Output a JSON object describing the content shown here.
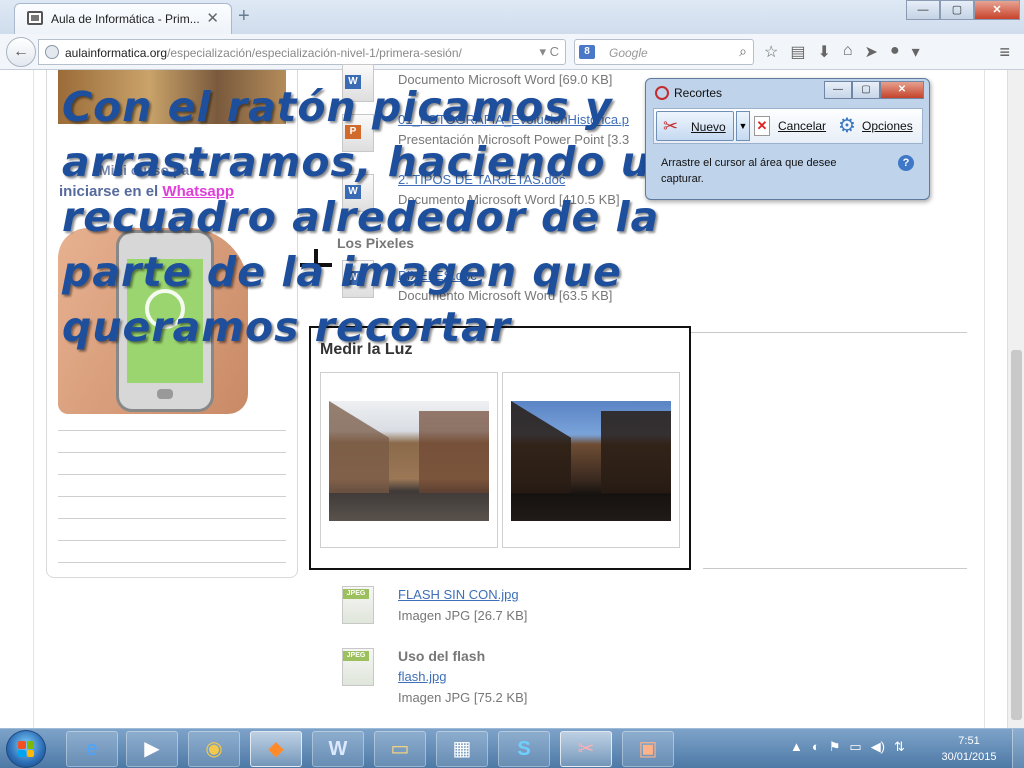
{
  "browser": {
    "tab_title": "Aula de Informática - Prim...",
    "tab_close": "✕",
    "new_tab": "+",
    "window_controls": [
      "—",
      "▢",
      "✕"
    ],
    "back": "←",
    "url_host": "aulainformatica.org",
    "url_path": "/especialización/especialización-nivel-1/primera-sesión/",
    "url_controls": "▾  C",
    "search_placeholder": "Google",
    "search_engine_letter": "8",
    "toolbar_icons": [
      "☆",
      "▤",
      "⬇",
      "⌂",
      "➤",
      "●",
      "▾"
    ],
    "menu": "≡"
  },
  "sidebar": {
    "promo_line1": "Mini curso para",
    "promo_line2_prefix": "iniciarse en el",
    "promo_line2_link": "Whatsapp"
  },
  "files": [
    {
      "meta": "Documento Microsoft Word [69.0 KB]"
    },
    {
      "link": "01_FOTOGRAFIA_EvolucionHistorica.p",
      "meta": "Presentación Microsoft Power Point [3.3"
    },
    {
      "link": "2. TIPOS DE TARJETAS.doc",
      "meta": "Documento Microsoft Word [410.5 KB]"
    }
  ],
  "section_pixeles": {
    "title": "Los Pixeles",
    "link": "PIXELES.doc",
    "meta": "Documento Microsoft Word [63.5 KB]"
  },
  "measure": {
    "title": "Medir la Luz"
  },
  "flash_files": [
    {
      "link": "FLASH SIN CON.jpg",
      "meta": "Imagen JPG [26.7 KB]"
    },
    {
      "section": "Uso del flash",
      "link": "flash.jpg",
      "meta": "Imagen JPG [75.2 KB]"
    }
  ],
  "file_badges": {
    "word": "W",
    "ppt": "P",
    "jpg": "JPEG"
  },
  "overlay_text": "Con el ratón picamos y arrastramos, haciendo un recuadro alrededor de la parte de la imagen que queramos recortar",
  "snipping_tool": {
    "title": "Recortes",
    "new_label": "Nuevo",
    "cancel_label": "Cancelar",
    "options_label": "Opciones",
    "hint": "Arrastre el cursor al área que desee capturar.",
    "help": "?",
    "window_controls": [
      "—",
      "▢",
      "✕"
    ]
  },
  "taskbar": {
    "apps": [
      "e",
      "▶",
      "◉",
      "◆",
      "W",
      "▭",
      "▦",
      "S",
      "✂",
      "▣"
    ],
    "tray_icons": [
      "▲",
      "◐",
      "⚑",
      "▭",
      "◀)",
      "⇅"
    ],
    "time": "7:51",
    "date": "30/01/2015"
  },
  "colors": {
    "overlay_text": "#1d4f9c",
    "link": "#3e6fb8",
    "whatsapp_link": "#e03ed8"
  }
}
